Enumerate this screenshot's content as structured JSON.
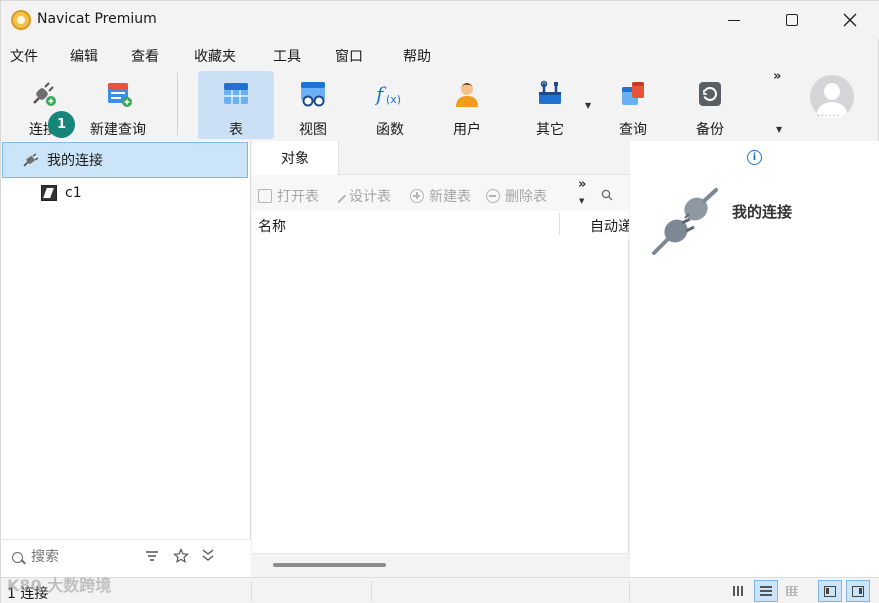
{
  "window": {
    "title": "Navicat Premium"
  },
  "menu": [
    "文件",
    "编辑",
    "查看",
    "收藏夹",
    "工具",
    "窗口",
    "帮助"
  ],
  "toolbar": {
    "connect": "连接",
    "new_query": "新建查询",
    "table": "表",
    "view": "视图",
    "function": "函数",
    "user": "用户",
    "other": "其它",
    "query": "查询",
    "backup": "备份",
    "badge": "1",
    "more": "»"
  },
  "tree": {
    "root": "我的连接",
    "children": [
      "c1"
    ]
  },
  "left_bottom": {
    "search_placeholder": "搜索"
  },
  "object_tabs": [
    "对象"
  ],
  "object_toolbar": {
    "open_table": "打开表",
    "design_table": "设计表",
    "new_table": "新建表",
    "delete_table": "删除表",
    "more": "»"
  },
  "object_columns": {
    "name": "名称",
    "auto": "自动递增值"
  },
  "detail": {
    "name": "我的连接"
  },
  "status": {
    "text": "1 连接",
    "watermark": "K80 大数跨境"
  },
  "colors": {
    "accent": "#17867a",
    "selection": "#cce4f7",
    "active_tool": "#cce0f5"
  }
}
